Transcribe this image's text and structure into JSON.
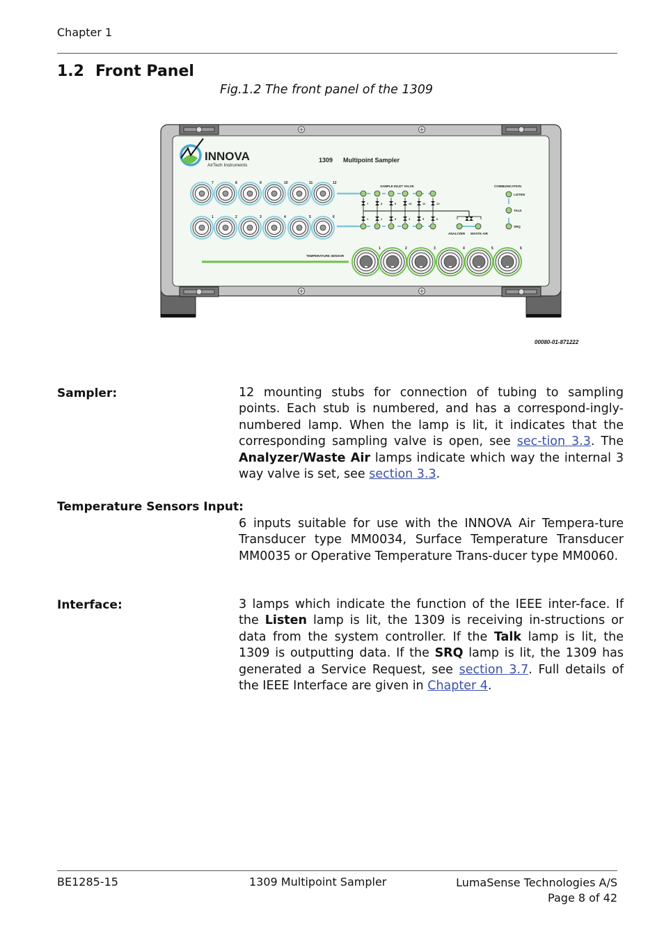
{
  "header": {
    "chapter": "Chapter 1"
  },
  "section": {
    "number": "1.2",
    "title": "Front Panel"
  },
  "figure": {
    "caption": "Fig.1.2  The front panel of the 1309",
    "code": "00080-01-871222",
    "device": {
      "brand": "INNOVA",
      "brand_sub": "AirTech Instruments",
      "model": "1309",
      "model_name": "Multipoint Sampler",
      "valve_label": "SAMPLE INLET VALVE",
      "comm_label": "COMMUNICATION",
      "top_stub_numbers": [
        "7",
        "8",
        "9",
        "10",
        "11",
        "12"
      ],
      "bottom_stub_numbers": [
        "1",
        "2",
        "3",
        "4",
        "5",
        "6"
      ],
      "lamp_labels": [
        "LISTEN",
        "TALK",
        "SRQ"
      ],
      "analyzer_label": "ANALYZER",
      "waste_air_label": "WASTE AIR",
      "sensor_label": "TEMPERATURE SENSOR",
      "sensor_numbers": [
        "1",
        "2",
        "3",
        "4",
        "5",
        "6"
      ],
      "colors": {
        "panel_face": "#f3f8f2",
        "bezel": "#c4c4c4",
        "stub_ring": "#8fd0e0",
        "sensor_ring": "#6cc24a",
        "lamp": "#9ed27f",
        "accent_line": "#6cc24a",
        "blue_line": "#7cc6dc"
      }
    }
  },
  "entries": [
    {
      "term": "Sampler:",
      "parts": [
        {
          "t": "12 mounting stubs for connection of tubing to sampling points. Each stub is numbered, and has a correspond-ingly-numbered lamp. When the lamp is lit, it indicates that the corresponding sampling valve is open, see "
        },
        {
          "link": "sec-tion 3.3"
        },
        {
          "t": ". The "
        },
        {
          "b": "Analyzer/Waste Air"
        },
        {
          "t": " lamps indicate which way the internal 3 way valve is set, see "
        },
        {
          "link": "section 3.3"
        },
        {
          "t": "."
        }
      ]
    },
    {
      "term": "Temperature Sensors Input:",
      "parts": [
        {
          "t": "6 inputs suitable for use with the INNOVA Air Tempera-ture Transducer type MM0034, Surface Temperature Transducer MM0035 or Operative Temperature Trans-ducer type MM0060."
        }
      ]
    },
    {
      "term": "Interface:",
      "parts": [
        {
          "t": "3 lamps which indicate the function of the IEEE inter-face. If the "
        },
        {
          "b": "Listen"
        },
        {
          "t": " lamp is lit, the 1309 is receiving in-structions or data from the system controller. If the "
        },
        {
          "b": "Talk"
        },
        {
          "t": " lamp is lit, the 1309 is outputting data. If the "
        },
        {
          "b": "SRQ"
        },
        {
          "t": " lamp is lit, the 1309 has generated a Service Request, see "
        },
        {
          "link": "section 3.7"
        },
        {
          "t": ". Full details of the IEEE Interface are given in "
        },
        {
          "link": "Chapter 4"
        },
        {
          "t": "."
        }
      ]
    }
  ],
  "footer": {
    "doc_id": "BE1285-15",
    "product": "1309 Multipoint Sampler",
    "company": "LumaSense Technologies A/S",
    "page": "Page 8 of 42"
  }
}
